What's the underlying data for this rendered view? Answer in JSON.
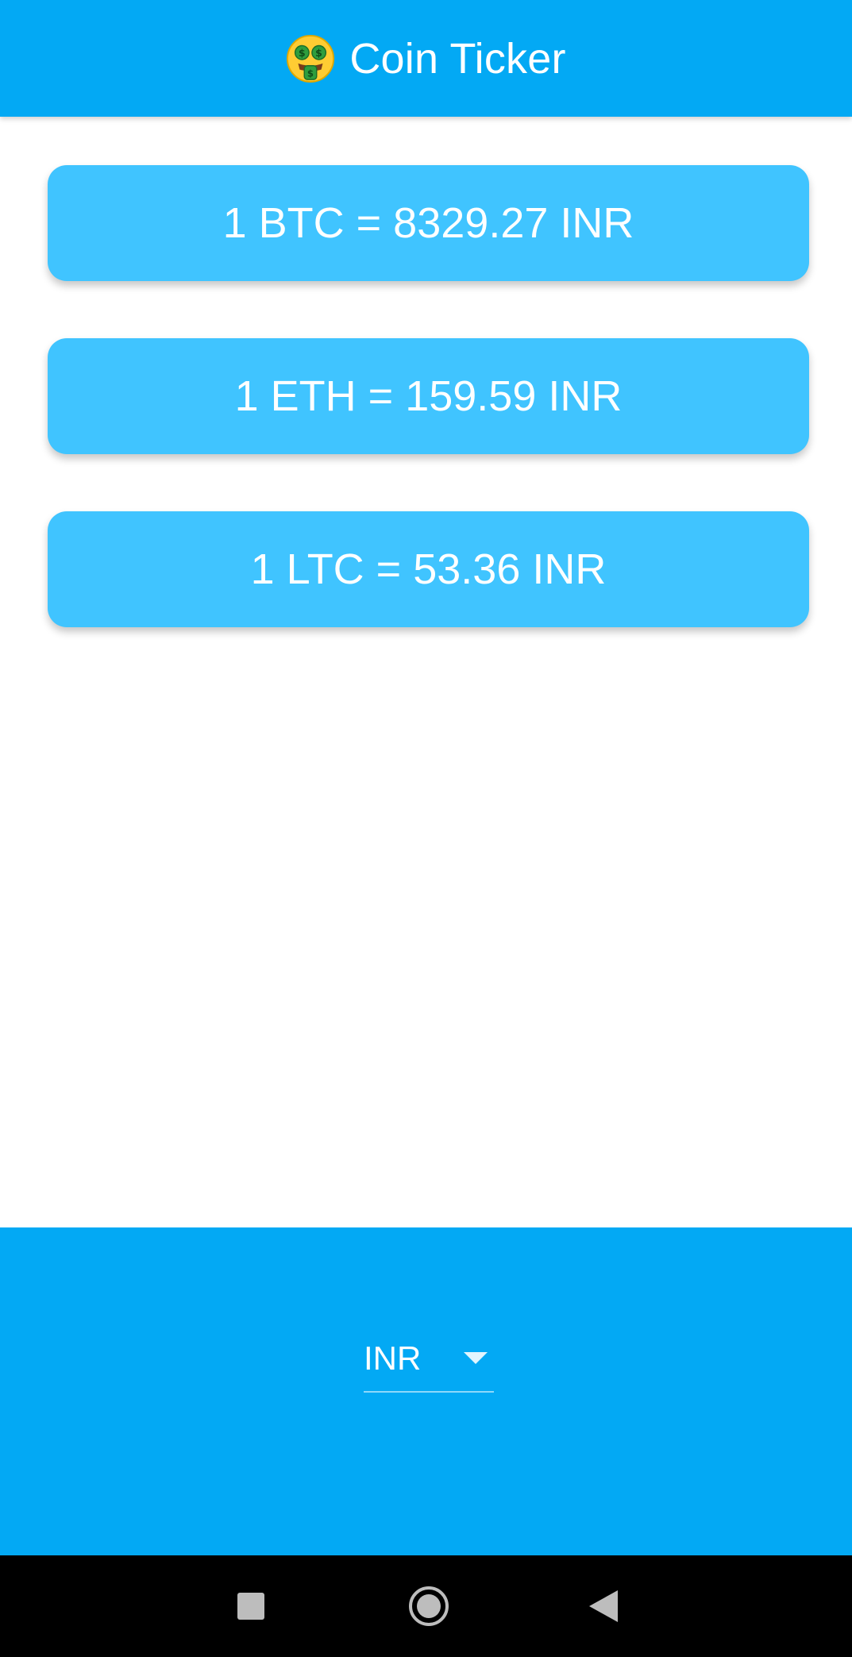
{
  "app_bar": {
    "title": "Coin Ticker",
    "title_icon": "money-mouth-face-icon",
    "color": "#03A9F4"
  },
  "rates": [
    {
      "coin": "BTC",
      "text": "1 BTC = 8329.27 INR"
    },
    {
      "coin": "ETH",
      "text": "1 ETH = 159.59 INR"
    },
    {
      "coin": "LTC",
      "text": "1 LTC = 53.36 INR"
    }
  ],
  "card_color": "#40C4FF",
  "currency_picker": {
    "selected": "INR",
    "icon": "arrow-drop-down-icon"
  },
  "nav_bar": {
    "recents_icon": "square-recents-icon",
    "home_icon": "circle-home-icon",
    "back_icon": "triangle-back-icon"
  }
}
